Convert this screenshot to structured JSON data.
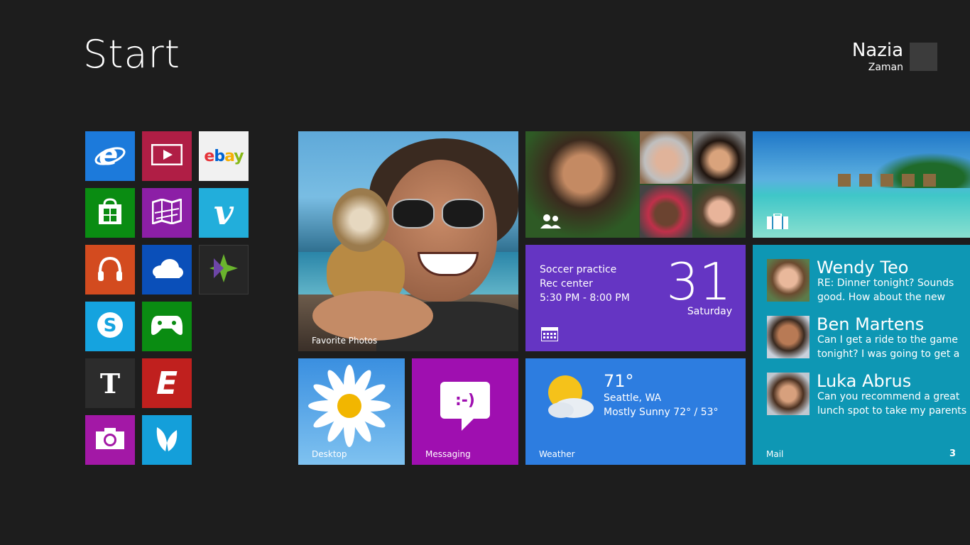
{
  "header": {
    "title": "Start"
  },
  "user": {
    "first_name": "Nazia",
    "last_name": "Zaman"
  },
  "apps": [
    {
      "name": "internet-explorer",
      "color": "#1c7adb"
    },
    {
      "name": "video",
      "color": "#b01e45"
    },
    {
      "name": "ebay",
      "color": "#f1f1f1",
      "text": "ebay"
    },
    {
      "name": "store",
      "color": "#0a8c12"
    },
    {
      "name": "maps",
      "color": "#8c1fa6"
    },
    {
      "name": "vimeo",
      "color": "#22aedb",
      "text": "v"
    },
    {
      "name": "music",
      "color": "#d34b1f"
    },
    {
      "name": "skydrive",
      "color": "#0a4fb9"
    },
    {
      "name": "etrade",
      "color": "#262626"
    },
    {
      "name": "skype",
      "color": "#15a3df"
    },
    {
      "name": "games",
      "color": "#0a8c12"
    },
    {
      "name": "nytimes",
      "color": "#2c2c2c",
      "text": "T"
    },
    {
      "name": "espn",
      "color": "#c0201e",
      "text": "E"
    },
    {
      "name": "camera",
      "color": "#a318a6"
    },
    {
      "name": "butterfly-app",
      "color": "#149fda"
    }
  ],
  "tiles": {
    "photos": {
      "label": "Favorite Photos"
    },
    "desktop": {
      "label": "Desktop"
    },
    "messaging": {
      "label": "Messaging",
      "emoticon": ":-)"
    },
    "calendar": {
      "event": "Soccer practice",
      "location": "Rec center",
      "time": "5:30 PM - 8:00 PM",
      "day": "31",
      "weekday": "Saturday"
    },
    "weather": {
      "label": "Weather",
      "temp": "71°",
      "city": "Seattle, WA",
      "condition": "Mostly Sunny  72° / 53°"
    },
    "mail": {
      "label": "Mail",
      "count": "3",
      "messages": [
        {
          "from": "Wendy Teo",
          "snippet": "RE: Dinner tonight? Sounds good. How about the new"
        },
        {
          "from": "Ben Martens",
          "snippet": "Can I get a ride to the game tonight? I was going to get a"
        },
        {
          "from": "Luka Abrus",
          "snippet": "Can you recommend a great lunch spot to take my parents"
        }
      ]
    }
  },
  "colors": {
    "background": "#1d1d1d",
    "calendar": "#6535c3",
    "messaging": "#9f0fb0",
    "weather": "#2d7de0",
    "mail": "#0e97b4"
  }
}
